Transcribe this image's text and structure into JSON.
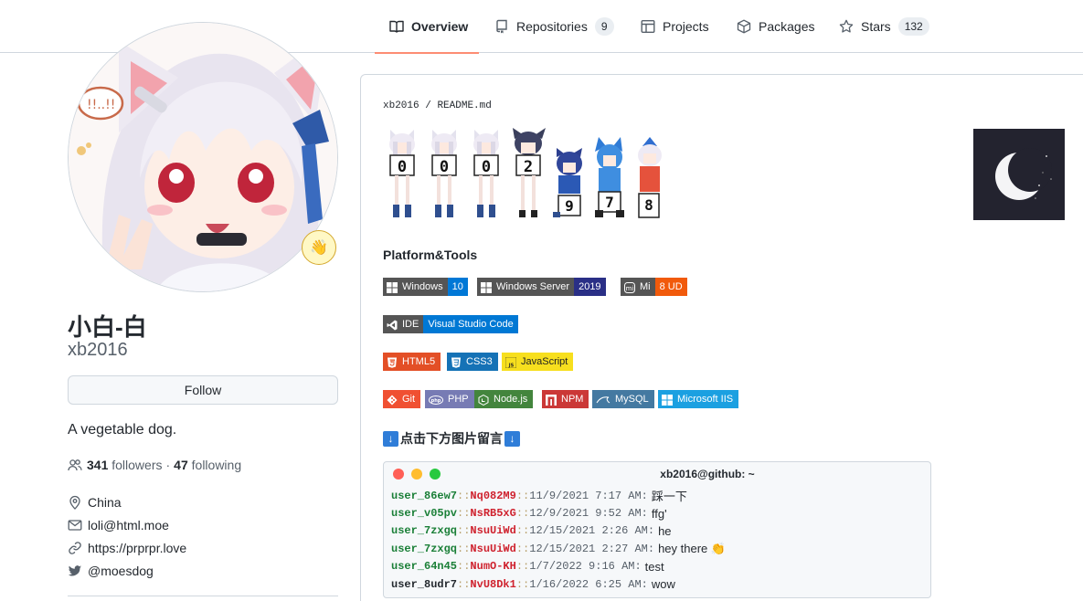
{
  "nav": {
    "tabs": [
      {
        "label": "Overview",
        "icon": "book-icon"
      },
      {
        "label": "Repositories",
        "icon": "repo-icon",
        "count": "9"
      },
      {
        "label": "Projects",
        "icon": "table-icon"
      },
      {
        "label": "Packages",
        "icon": "package-icon"
      },
      {
        "label": "Stars",
        "icon": "star-icon",
        "count": "132"
      }
    ]
  },
  "profile": {
    "full_name": "小白-白",
    "username": "xb2016",
    "status_emoji": "👋",
    "follow_label": "Follow",
    "bio": "A vegetable dog.",
    "followers_count": "341",
    "followers_label": "followers",
    "dot": "·",
    "following_count": "47",
    "following_label": "following",
    "location": "China",
    "email": "loli@html.moe",
    "website": "https://prprpr.love",
    "twitter": "@moesdog"
  },
  "readme": {
    "path_user": "xb2016",
    "path_sep": "/",
    "path_file": "README.md",
    "counter_digits": [
      "0",
      "0",
      "0",
      "2",
      "9",
      "7",
      "8"
    ],
    "platform_title": "Platform&Tools",
    "notice": "点击下方图片留言",
    "notice_arrow": "↓"
  },
  "badges": {
    "windows_l": "Windows",
    "windows_r": "10",
    "winserver_l": "Windows Server",
    "winserver_r": "2019",
    "mi_l": "Mi",
    "mi_r": "8 UD",
    "ide_l": "IDE",
    "ide_r": "Visual Studio Code",
    "html5": "HTML5",
    "css3": "CSS3",
    "js": "JavaScript",
    "git": "Git",
    "php": "PHP",
    "node": "Node.js",
    "npm": "NPM",
    "mysql": "MySQL",
    "iis": "Microsoft IIS"
  },
  "terminal": {
    "title": "xb2016@github: ~",
    "lines": [
      {
        "user": "user_86ew7",
        "hash": "Nq082M9",
        "time": "11/9/2021 7:17 AM",
        "msg": "踩一下"
      },
      {
        "user": "user_v05pv",
        "hash": "NsRB5xG",
        "time": "12/9/2021 9:52 AM",
        "msg": "ffg'"
      },
      {
        "user": "user_7zxgq",
        "hash": "NsuUiWd",
        "time": "12/15/2021 2:26 AM",
        "msg": "he"
      },
      {
        "user": "user_7zxgq",
        "hash": "NsuUiWd",
        "time": "12/15/2021 2:27 AM",
        "msg": "hey there 👏"
      },
      {
        "user": "user_64n45",
        "hash": "NumO-KH",
        "time": "1/7/2022 9:16 AM",
        "msg": "test"
      },
      {
        "user": "user_8udr7",
        "hash": "NvU8Dk1",
        "time": "1/16/2022 6:25 AM",
        "msg": "wow"
      }
    ]
  }
}
